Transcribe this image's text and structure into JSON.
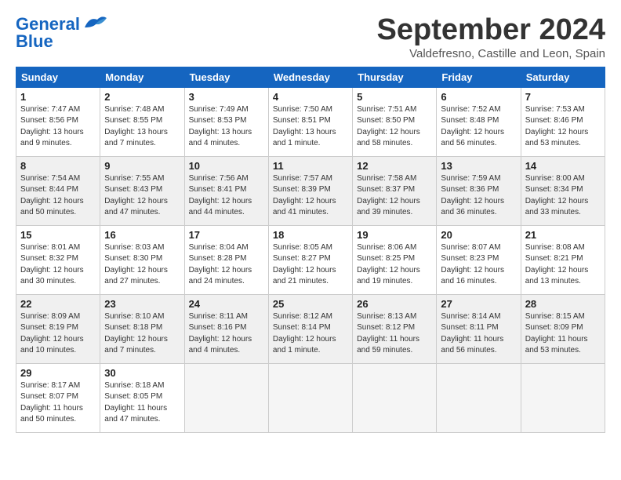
{
  "logo": {
    "line1": "General",
    "line2": "Blue"
  },
  "title": "September 2024",
  "subtitle": "Valdefresno, Castille and Leon, Spain",
  "headers": [
    "Sunday",
    "Monday",
    "Tuesday",
    "Wednesday",
    "Thursday",
    "Friday",
    "Saturday"
  ],
  "rows": [
    [
      {
        "day": "1",
        "info": "Sunrise: 7:47 AM\nSunset: 8:56 PM\nDaylight: 13 hours\nand 9 minutes."
      },
      {
        "day": "2",
        "info": "Sunrise: 7:48 AM\nSunset: 8:55 PM\nDaylight: 13 hours\nand 7 minutes."
      },
      {
        "day": "3",
        "info": "Sunrise: 7:49 AM\nSunset: 8:53 PM\nDaylight: 13 hours\nand 4 minutes."
      },
      {
        "day": "4",
        "info": "Sunrise: 7:50 AM\nSunset: 8:51 PM\nDaylight: 13 hours\nand 1 minute."
      },
      {
        "day": "5",
        "info": "Sunrise: 7:51 AM\nSunset: 8:50 PM\nDaylight: 12 hours\nand 58 minutes."
      },
      {
        "day": "6",
        "info": "Sunrise: 7:52 AM\nSunset: 8:48 PM\nDaylight: 12 hours\nand 56 minutes."
      },
      {
        "day": "7",
        "info": "Sunrise: 7:53 AM\nSunset: 8:46 PM\nDaylight: 12 hours\nand 53 minutes."
      }
    ],
    [
      {
        "day": "8",
        "info": "Sunrise: 7:54 AM\nSunset: 8:44 PM\nDaylight: 12 hours\nand 50 minutes."
      },
      {
        "day": "9",
        "info": "Sunrise: 7:55 AM\nSunset: 8:43 PM\nDaylight: 12 hours\nand 47 minutes."
      },
      {
        "day": "10",
        "info": "Sunrise: 7:56 AM\nSunset: 8:41 PM\nDaylight: 12 hours\nand 44 minutes."
      },
      {
        "day": "11",
        "info": "Sunrise: 7:57 AM\nSunset: 8:39 PM\nDaylight: 12 hours\nand 41 minutes."
      },
      {
        "day": "12",
        "info": "Sunrise: 7:58 AM\nSunset: 8:37 PM\nDaylight: 12 hours\nand 39 minutes."
      },
      {
        "day": "13",
        "info": "Sunrise: 7:59 AM\nSunset: 8:36 PM\nDaylight: 12 hours\nand 36 minutes."
      },
      {
        "day": "14",
        "info": "Sunrise: 8:00 AM\nSunset: 8:34 PM\nDaylight: 12 hours\nand 33 minutes."
      }
    ],
    [
      {
        "day": "15",
        "info": "Sunrise: 8:01 AM\nSunset: 8:32 PM\nDaylight: 12 hours\nand 30 minutes."
      },
      {
        "day": "16",
        "info": "Sunrise: 8:03 AM\nSunset: 8:30 PM\nDaylight: 12 hours\nand 27 minutes."
      },
      {
        "day": "17",
        "info": "Sunrise: 8:04 AM\nSunset: 8:28 PM\nDaylight: 12 hours\nand 24 minutes."
      },
      {
        "day": "18",
        "info": "Sunrise: 8:05 AM\nSunset: 8:27 PM\nDaylight: 12 hours\nand 21 minutes."
      },
      {
        "day": "19",
        "info": "Sunrise: 8:06 AM\nSunset: 8:25 PM\nDaylight: 12 hours\nand 19 minutes."
      },
      {
        "day": "20",
        "info": "Sunrise: 8:07 AM\nSunset: 8:23 PM\nDaylight: 12 hours\nand 16 minutes."
      },
      {
        "day": "21",
        "info": "Sunrise: 8:08 AM\nSunset: 8:21 PM\nDaylight: 12 hours\nand 13 minutes."
      }
    ],
    [
      {
        "day": "22",
        "info": "Sunrise: 8:09 AM\nSunset: 8:19 PM\nDaylight: 12 hours\nand 10 minutes."
      },
      {
        "day": "23",
        "info": "Sunrise: 8:10 AM\nSunset: 8:18 PM\nDaylight: 12 hours\nand 7 minutes."
      },
      {
        "day": "24",
        "info": "Sunrise: 8:11 AM\nSunset: 8:16 PM\nDaylight: 12 hours\nand 4 minutes."
      },
      {
        "day": "25",
        "info": "Sunrise: 8:12 AM\nSunset: 8:14 PM\nDaylight: 12 hours\nand 1 minute."
      },
      {
        "day": "26",
        "info": "Sunrise: 8:13 AM\nSunset: 8:12 PM\nDaylight: 11 hours\nand 59 minutes."
      },
      {
        "day": "27",
        "info": "Sunrise: 8:14 AM\nSunset: 8:11 PM\nDaylight: 11 hours\nand 56 minutes."
      },
      {
        "day": "28",
        "info": "Sunrise: 8:15 AM\nSunset: 8:09 PM\nDaylight: 11 hours\nand 53 minutes."
      }
    ],
    [
      {
        "day": "29",
        "info": "Sunrise: 8:17 AM\nSunset: 8:07 PM\nDaylight: 11 hours\nand 50 minutes."
      },
      {
        "day": "30",
        "info": "Sunrise: 8:18 AM\nSunset: 8:05 PM\nDaylight: 11 hours\nand 47 minutes."
      },
      {
        "day": "",
        "info": ""
      },
      {
        "day": "",
        "info": ""
      },
      {
        "day": "",
        "info": ""
      },
      {
        "day": "",
        "info": ""
      },
      {
        "day": "",
        "info": ""
      }
    ]
  ]
}
